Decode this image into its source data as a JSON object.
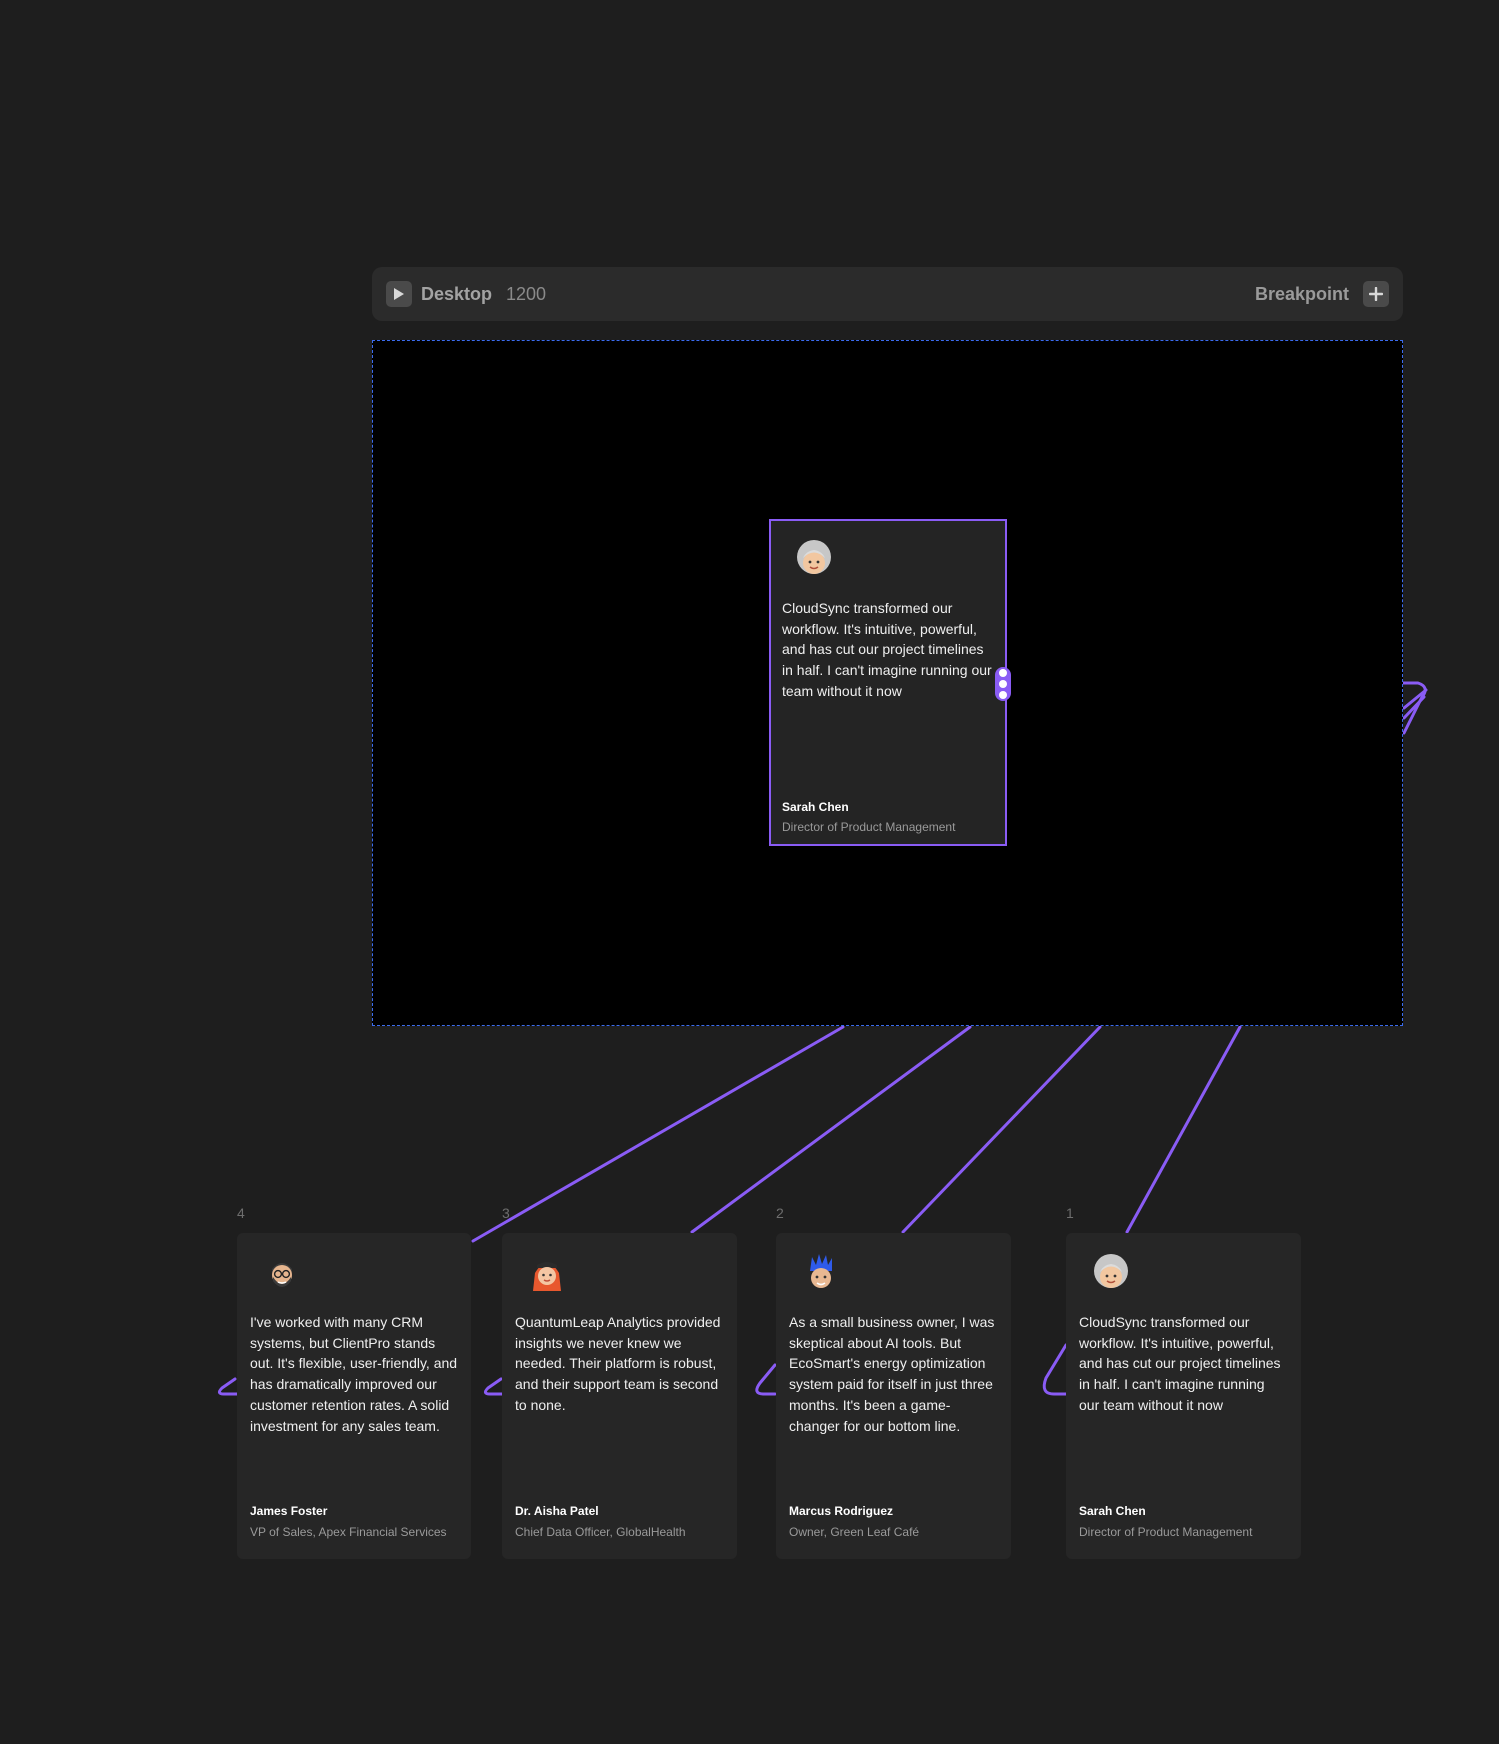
{
  "breakpoint": {
    "play_icon": "play-icon",
    "name": "Desktop",
    "width": "1200",
    "add_label": "Breakpoint",
    "add_icon": "plus-icon"
  },
  "colors": {
    "canvas": "#1e1e1e",
    "frame": "#000000",
    "frame_border": "#3b6cf0",
    "accent": "#8a5cf5",
    "card": "#262626"
  },
  "selected_card": {
    "avatar_icon": "avatar-grey-haired-woman-icon",
    "quote": "CloudSync transformed our workflow. It's intuitive, powerful, and has cut our project timelines in half. I can't imagine running our team without it now",
    "author": "Sarah Chen",
    "role": "Director of Product Management"
  },
  "cards": [
    {
      "index": "4",
      "avatar_icon": "avatar-bearded-man-glasses-icon",
      "quote": "I've worked with many CRM systems, but ClientPro stands out. It's flexible, user-friendly, and has dramatically improved our customer retention rates. A solid investment for any sales team.",
      "author": "James Foster",
      "role": "VP of Sales, Apex Financial Services"
    },
    {
      "index": "3",
      "avatar_icon": "avatar-red-haired-woman-icon",
      "quote": "QuantumLeap Analytics provided insights we never knew we needed. Their platform is robust, and their support team is second to none.",
      "author": "Dr. Aisha Patel",
      "role": "Chief Data Officer, GlobalHealth"
    },
    {
      "index": "2",
      "avatar_icon": "avatar-blue-spiky-hair-man-icon",
      "quote": "As a small business owner, I was skeptical about AI tools. But EcoSmart's energy optimization system paid for itself in just three months. It's been a game-changer for our bottom line.",
      "author": "Marcus Rodriguez",
      "role": "Owner, Green Leaf Café"
    },
    {
      "index": "1",
      "avatar_icon": "avatar-grey-haired-woman-icon",
      "quote": "CloudSync transformed our workflow. It's intuitive, powerful, and has cut our project timelines in half. I can't imagine running our team without it now",
      "author": "Sarah Chen",
      "role": "Director of Product Management"
    }
  ]
}
